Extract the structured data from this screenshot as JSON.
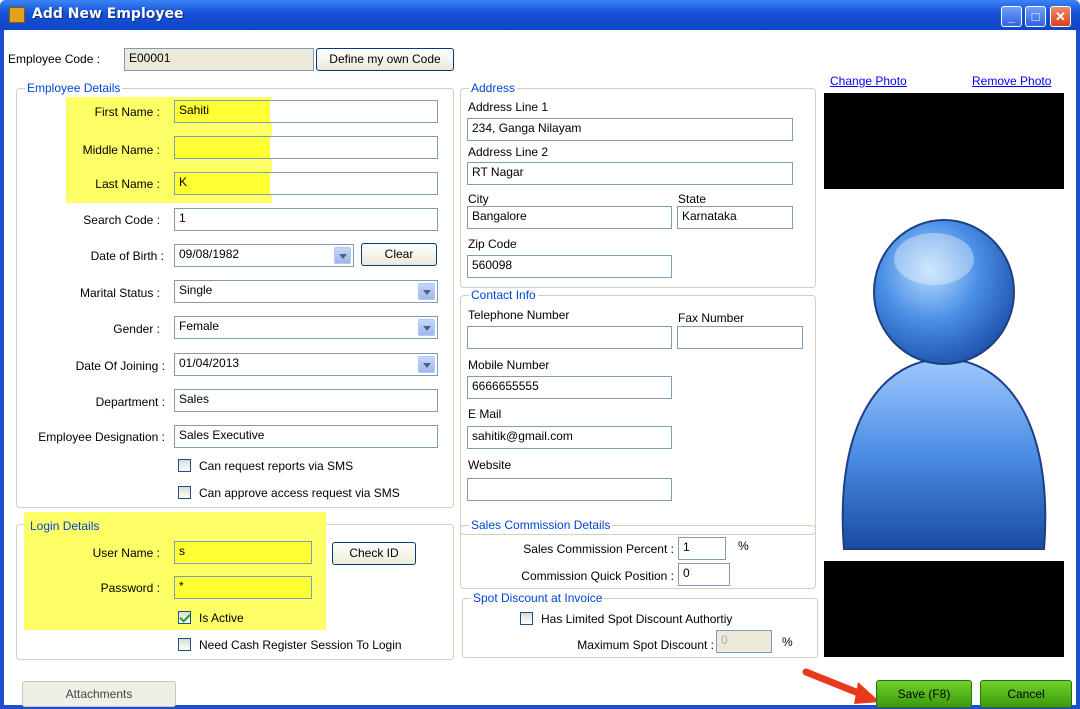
{
  "window": {
    "title": "Add New Employee"
  },
  "employee_code": {
    "label": "Employee Code :",
    "value": "E00001",
    "define_button": "Define my own Code"
  },
  "employee_details": {
    "title": "Employee Details",
    "first_name": {
      "label": "First Name :",
      "value": "Sahiti"
    },
    "middle_name": {
      "label": "Middle Name :",
      "value": ""
    },
    "last_name": {
      "label": "Last Name :",
      "value": "K"
    },
    "search_code": {
      "label": "Search Code :",
      "value": "1"
    },
    "dob": {
      "label": "Date of Birth :",
      "value": "09/08/1982",
      "clear": "Clear"
    },
    "marital_status": {
      "label": "Marital Status :",
      "value": "Single"
    },
    "gender": {
      "label": "Gender :",
      "value": "Female"
    },
    "doj": {
      "label": "Date Of Joining :",
      "value": "01/04/2013"
    },
    "department": {
      "label": "Department :",
      "value": "Sales"
    },
    "designation": {
      "label": "Employee Designation :",
      "value": "Sales Executive"
    },
    "sms_reports": "Can request reports via SMS",
    "sms_approve": "Can approve access request via SMS"
  },
  "login": {
    "title": "Login Details",
    "username": {
      "label": "User Name :",
      "value": "s"
    },
    "password": {
      "label": "Password :",
      "value": "*"
    },
    "check_id": "Check ID",
    "is_active": "Is Active",
    "cash_register": "Need Cash Register Session To Login"
  },
  "address": {
    "title": "Address",
    "line1": {
      "label": "Address Line 1",
      "value": "234, Ganga Nilayam"
    },
    "line2": {
      "label": "Address Line 2",
      "value": "RT Nagar"
    },
    "city": {
      "label": "City",
      "value": "Bangalore"
    },
    "state": {
      "label": "State",
      "value": "Karnataka"
    },
    "zip": {
      "label": "Zip Code",
      "value": "560098"
    }
  },
  "contact": {
    "title": "Contact Info",
    "telephone": {
      "label": "Telephone Number",
      "value": ""
    },
    "fax": {
      "label": "Fax Number",
      "value": ""
    },
    "mobile": {
      "label": "Mobile Number",
      "value": "6666655555"
    },
    "email": {
      "label": "E Mail",
      "value": "sahitik@gmail.com"
    },
    "website": {
      "label": "Website",
      "value": ""
    }
  },
  "commission": {
    "title": "Sales Commission Details",
    "percent": {
      "label": "Sales Commission Percent :",
      "value": "1",
      "unit": "%"
    },
    "quick": {
      "label": "Commission Quick Position :",
      "value": "0"
    }
  },
  "spot": {
    "title": "Spot Discount at Invoice",
    "limited": "Has Limited Spot Discount Authortiy",
    "max": {
      "label": "Maximum Spot Discount :",
      "value": "0",
      "unit": "%"
    }
  },
  "photo": {
    "change": "Change Photo",
    "remove": "Remove Photo"
  },
  "buttons": {
    "attachments": "Attachments",
    "save": "Save (F8)",
    "cancel": "Cancel"
  }
}
